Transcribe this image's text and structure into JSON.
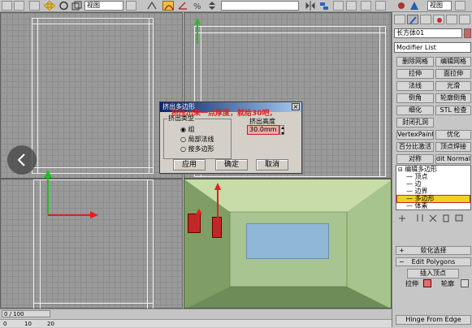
{
  "toolbar": {
    "view_select": "视图",
    "viewport_select": "视图"
  },
  "command_panel": {
    "object_name": "长方体01",
    "modifier_list": "Modifier List",
    "buttons": [
      [
        "删除网格",
        "编辑网格"
      ],
      [
        "拉伸",
        "面拉伸"
      ],
      [
        "法线",
        "光滑"
      ],
      [
        "倒角",
        "轮廓倒角"
      ],
      [
        "细化",
        "STL 检查"
      ],
      [
        "封闭孔洞",
        ""
      ],
      [
        "VertexPaint",
        "优化"
      ],
      [
        "百分比激活",
        "顶点焊接"
      ],
      [
        "对称",
        "dit Normal"
      ]
    ],
    "stack": [
      {
        "label": "编辑多边形",
        "level": 0
      },
      {
        "label": "顶点",
        "level": 1
      },
      {
        "label": "边",
        "level": 1
      },
      {
        "label": "边界",
        "level": 1
      },
      {
        "label": "多边形",
        "level": 1,
        "selected": true
      },
      {
        "label": "体素",
        "level": 1
      }
    ],
    "rollout_soft": "软化选择",
    "rollout_edit": "Edit Polygons",
    "insert_vertex": "插入顶点",
    "extrude": "拉伸",
    "outline": "轮廓",
    "hinge": "Hinge From Edge"
  },
  "dialog": {
    "title": "挤出多边形",
    "annotation": "挤压出来一点厚度，就给30吧，",
    "group_label": "挤出类型",
    "options": [
      "组",
      "局部法线",
      "按多边形"
    ],
    "selected_option": 0,
    "height_label": "挤出高度",
    "height_value": "30.0mm",
    "apply": "应用",
    "ok": "确定",
    "cancel": "取消"
  },
  "timeline": {
    "frame": "0 / 100",
    "ticks": [
      "0",
      "10",
      "20"
    ]
  },
  "colors": {
    "annotation_red": "#e0201a",
    "stack_highlight": "#f0d020",
    "room_green": "#86a66c"
  }
}
